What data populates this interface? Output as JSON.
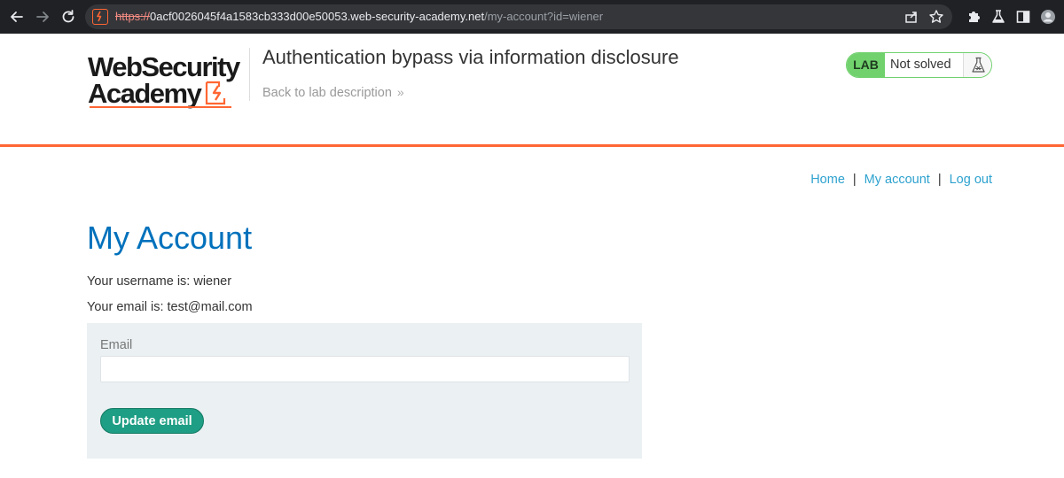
{
  "browser": {
    "url_scheme": "https://",
    "url_host": "0acf0026045f4a1583cb333d00e50053.web-security-academy.net",
    "url_path": "/my-account?id=wiener",
    "icons": [
      "back-arrow-icon",
      "forward-arrow-icon",
      "reload-icon",
      "share-icon",
      "star-icon",
      "extensions-icon",
      "flask-icon",
      "sidebar-icon",
      "profile-icon"
    ]
  },
  "logo": {
    "line1": "WebSecurity",
    "line2": "Academy",
    "accent_color": "#ff6633"
  },
  "lab": {
    "title": "Authentication bypass via information disclosure",
    "back_link": "Back to lab description",
    "badge": "LAB",
    "status": "Not solved",
    "badge_color": "#70d16d"
  },
  "nav": {
    "home": "Home",
    "separator": "|",
    "my_account": "My account",
    "log_out": "Log out",
    "link_color": "#2ea2cf"
  },
  "account": {
    "title": "My Account",
    "username_line": "Your username is: wiener",
    "email_line": "Your email is: test@mail.com",
    "title_color": "#0071bc"
  },
  "form": {
    "email_label": "Email",
    "email_value": "",
    "submit_label": "Update email",
    "button_color": "#1e9e84"
  }
}
